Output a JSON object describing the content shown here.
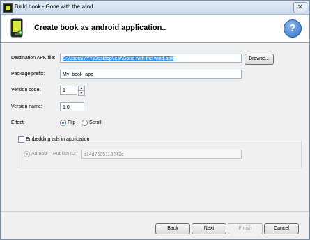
{
  "window": {
    "title": "Build book - Gone with the wind",
    "close_glyph": "✕"
  },
  "header": {
    "title": "Create book as android application..",
    "help_glyph": "?"
  },
  "form": {
    "destination_label": "Destination APK file:",
    "destination_value": "C:\\Users\\YYY\\Desktop\\test\\Gone with the wind.apk",
    "browse_label": "Browse...",
    "package_label": "Package prefix:",
    "package_value": "My_book_app",
    "version_code_label": "Version code:",
    "version_code_value": "1",
    "version_name_label": "Version name:",
    "version_name_value": "1.0",
    "effect_label": "Effect:",
    "effect_options": [
      "Flip",
      "Scroll"
    ],
    "effect_selected": "Flip",
    "ads_label": "Embedding ads in application",
    "ads_checked": false,
    "admob_label": "Admob",
    "publish_id_label": "Publish ID:",
    "publish_id_value": "a14d7605118242c"
  },
  "buttons": {
    "back": "Back",
    "next": "Next",
    "finish": "Finish",
    "cancel": "Cancel"
  }
}
